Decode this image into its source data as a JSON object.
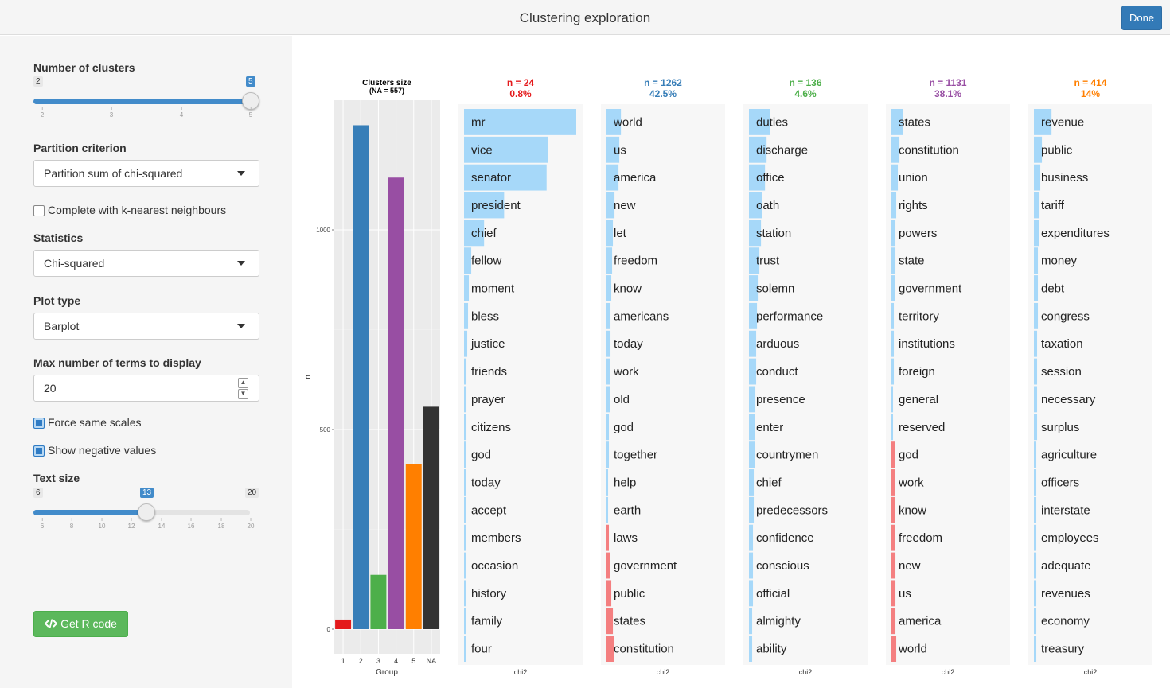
{
  "window": {
    "title": "Clustering exploration",
    "done_label": "Done"
  },
  "sidebar": {
    "num_clusters": {
      "label": "Number of clusters",
      "min": "2",
      "max": "5",
      "value": "5",
      "ticks": [
        "2",
        "3",
        "4",
        "5"
      ]
    },
    "partition": {
      "label": "Partition criterion",
      "value": "Partition sum of chi-squared"
    },
    "knn": {
      "label": "Complete with k-nearest neighbours",
      "checked": false
    },
    "statistics": {
      "label": "Statistics",
      "value": "Chi-squared"
    },
    "plot_type": {
      "label": "Plot type",
      "value": "Barplot"
    },
    "max_terms": {
      "label": "Max number of terms to display",
      "value": "20"
    },
    "same_scales": {
      "label": "Force same scales",
      "checked": true
    },
    "negative": {
      "label": "Show negative values",
      "checked": true
    },
    "text_size": {
      "label": "Text size",
      "min": "6",
      "max": "20",
      "value": "13",
      "ticks": [
        "6",
        "8",
        "10",
        "12",
        "14",
        "16",
        "18",
        "20"
      ]
    },
    "rcode": {
      "label": "Get R code",
      "icon": "code-icon"
    }
  },
  "chart_data": [
    {
      "type": "bar",
      "title": "Clusters size",
      "subtitle": "(NA = 557)",
      "xlabel": "Group",
      "ylabel": "n",
      "categories": [
        "1",
        "2",
        "3",
        "4",
        "5",
        "NA"
      ],
      "values": [
        24,
        1262,
        136,
        1131,
        414,
        557
      ],
      "colors": [
        "#e41a1c",
        "#377eb8",
        "#4daf4a",
        "#984ea3",
        "#ff7f00",
        "#333333"
      ],
      "ylim": [
        0,
        1300
      ],
      "yticks": [
        "0",
        "500",
        "1000"
      ]
    },
    {
      "type": "bar",
      "orientation": "horizontal",
      "xlabel": "chi2",
      "n_label": "n = 24",
      "pct_label": "0.8%",
      "color": "#e41a1c",
      "terms": [
        "mr",
        "vice",
        "senator",
        "president",
        "chief",
        "fellow",
        "moment",
        "bless",
        "justice",
        "friends",
        "prayer",
        "citizens",
        "god",
        "today",
        "accept",
        "members",
        "occasion",
        "history",
        "family",
        "four"
      ],
      "values": [
        140,
        105,
        103,
        50,
        25,
        9,
        6,
        5,
        4,
        3,
        3,
        3,
        2,
        2,
        2,
        1.5,
        1.5,
        1,
        1,
        0.5
      ]
    },
    {
      "type": "bar",
      "orientation": "horizontal",
      "xlabel": "chi2",
      "n_label": "n = 1262",
      "pct_label": "42.5%",
      "color": "#377eb8",
      "terms": [
        "world",
        "us",
        "america",
        "new",
        "let",
        "freedom",
        "know",
        "americans",
        "today",
        "work",
        "old",
        "god",
        "together",
        "help",
        "earth",
        "laws",
        "government",
        "public",
        "states",
        "constitution"
      ],
      "values": [
        18,
        16,
        15,
        10,
        8,
        7,
        6,
        5,
        5,
        4,
        4,
        3,
        3,
        2,
        2,
        -3,
        -4,
        -6,
        -8,
        -9
      ]
    },
    {
      "type": "bar",
      "orientation": "horizontal",
      "xlabel": "chi2",
      "n_label": "n = 136",
      "pct_label": "4.6%",
      "color": "#4daf4a",
      "terms": [
        "duties",
        "discharge",
        "office",
        "oath",
        "station",
        "trust",
        "solemn",
        "performance",
        "arduous",
        "conduct",
        "presence",
        "enter",
        "countrymen",
        "chief",
        "predecessors",
        "confidence",
        "conscious",
        "official",
        "almighty",
        "ability"
      ],
      "values": [
        26,
        22,
        20,
        16,
        15,
        13,
        11,
        10,
        9,
        9,
        8,
        7,
        7,
        6,
        6,
        5,
        5,
        5,
        4,
        4
      ]
    },
    {
      "type": "bar",
      "orientation": "horizontal",
      "xlabel": "chi2",
      "n_label": "n = 1131",
      "pct_label": "38.1%",
      "color": "#984ea3",
      "terms": [
        "states",
        "constitution",
        "union",
        "rights",
        "powers",
        "state",
        "government",
        "territory",
        "institutions",
        "foreign",
        "general",
        "reserved",
        "god",
        "work",
        "know",
        "freedom",
        "new",
        "us",
        "america",
        "world"
      ],
      "values": [
        14,
        10,
        8,
        6,
        5,
        5,
        4,
        3,
        3,
        3,
        2,
        2,
        -4,
        -4,
        -4,
        -4,
        -5,
        -5,
        -5,
        -6
      ]
    },
    {
      "type": "bar",
      "orientation": "horizontal",
      "xlabel": "chi2",
      "n_label": "n = 414",
      "pct_label": "14%",
      "color": "#ff7f00",
      "terms": [
        "revenue",
        "public",
        "business",
        "tariff",
        "expenditures",
        "money",
        "debt",
        "congress",
        "taxation",
        "session",
        "necessary",
        "surplus",
        "agriculture",
        "officers",
        "interstate",
        "employees",
        "adequate",
        "revenues",
        "economy",
        "treasury"
      ],
      "values": [
        22,
        10,
        8,
        7,
        6,
        5,
        5,
        5,
        4,
        4,
        4,
        4,
        3,
        3,
        3,
        3,
        3,
        3,
        3,
        3
      ]
    }
  ]
}
